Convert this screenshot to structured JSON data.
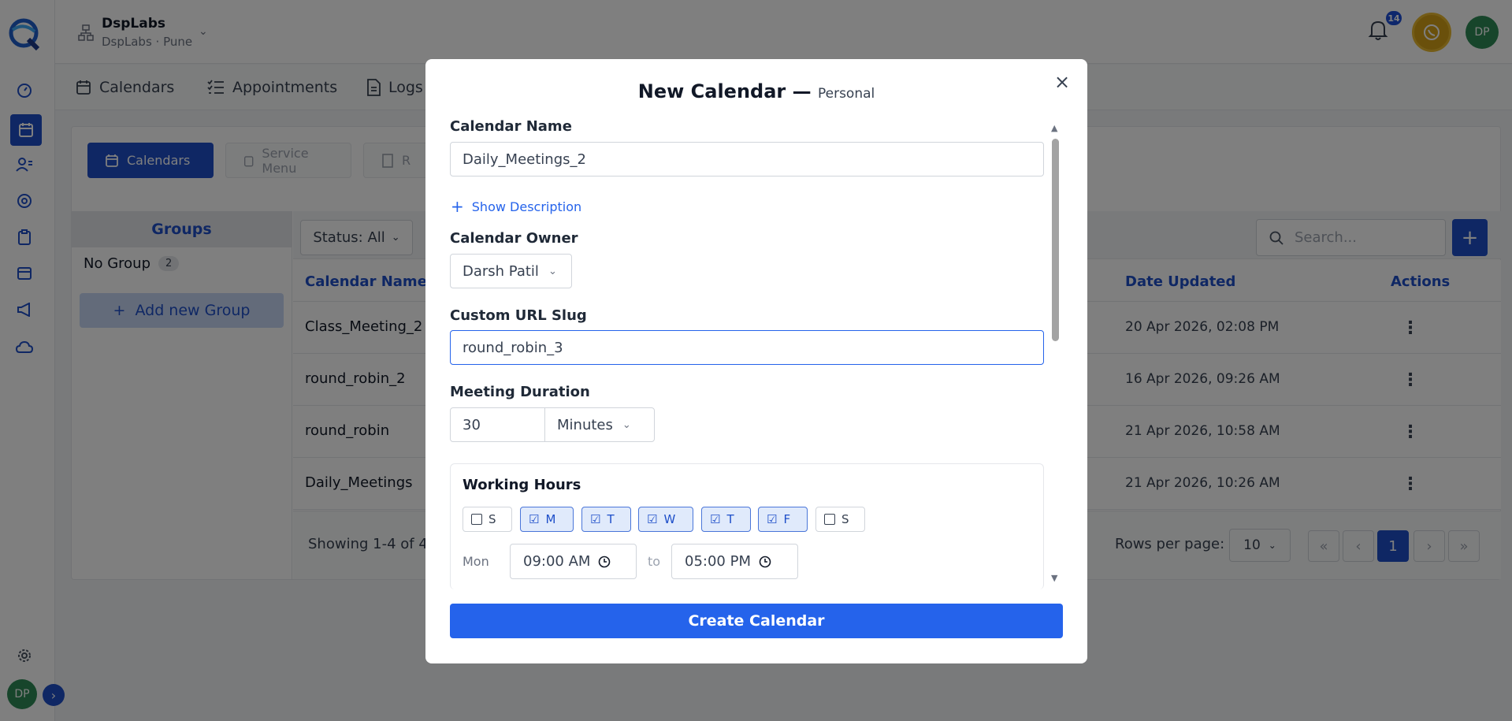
{
  "org": {
    "name": "DspLabs",
    "sub": "DspLabs · Pune"
  },
  "user": {
    "initials": "DP"
  },
  "notifications": {
    "count": "14"
  },
  "tabs": [
    {
      "label": "Calendars",
      "icon": "calendar-icon"
    },
    {
      "label": "Appointments",
      "icon": "list-icon"
    },
    {
      "label": "Logs",
      "icon": "document-icon"
    }
  ],
  "pills": [
    {
      "label": "Calendars",
      "icon": "calendar-icon"
    },
    {
      "label": "Service Menu",
      "icon": "clipboard-icon"
    },
    {
      "label": "R",
      "icon": "building-icon"
    }
  ],
  "groups": {
    "header": "Groups",
    "no_group": "No Group",
    "no_group_count": "2",
    "add_label": "Add new Group"
  },
  "filters": {
    "status": "Status: All",
    "search_placeholder": "Search..."
  },
  "table": {
    "columns": {
      "name": "Calendar Name",
      "date": "Date Updated",
      "actions": "Actions"
    },
    "rows": [
      {
        "name": "Class_Meeting_2",
        "date": "20 Apr 2026, 02:08 PM"
      },
      {
        "name": "round_robin_2",
        "date": "16 Apr 2026, 09:26 AM"
      },
      {
        "name": "round_robin",
        "date": "21 Apr 2026, 10:58 AM"
      },
      {
        "name": "Daily_Meetings",
        "date": "21 Apr 2026, 10:26 AM"
      }
    ],
    "showing": "Showing 1-4 of 4",
    "rows_per_page_label": "Rows per page:",
    "rows_per_page": "10",
    "current_page": "1"
  },
  "modal": {
    "title": "New Calendar —",
    "subtitle": "Personal",
    "calendar_name_label": "Calendar Name",
    "calendar_name_value": "Daily_Meetings_2",
    "show_description": "Show Description",
    "owner_label": "Calendar Owner",
    "owner_value": "Darsh Patil",
    "slug_label": "Custom URL Slug",
    "slug_value": "round_robin_3",
    "duration_label": "Meeting Duration",
    "duration_value": "30",
    "duration_unit": "Minutes",
    "working_hours": "Working Hours",
    "days": [
      {
        "label": "S",
        "checked": false
      },
      {
        "label": "M",
        "checked": true
      },
      {
        "label": "T",
        "checked": true
      },
      {
        "label": "W",
        "checked": true
      },
      {
        "label": "T",
        "checked": true
      },
      {
        "label": "F",
        "checked": true
      },
      {
        "label": "S",
        "checked": false
      }
    ],
    "mon_label": "Mon",
    "start_time": "09:00  AM",
    "to_label": "to",
    "end_time": "05:00  PM",
    "create_label": "Create Calendar"
  },
  "colors": {
    "primary": "#1e4fc9",
    "button": "#2563eb",
    "avatar": "#2e8b57"
  }
}
